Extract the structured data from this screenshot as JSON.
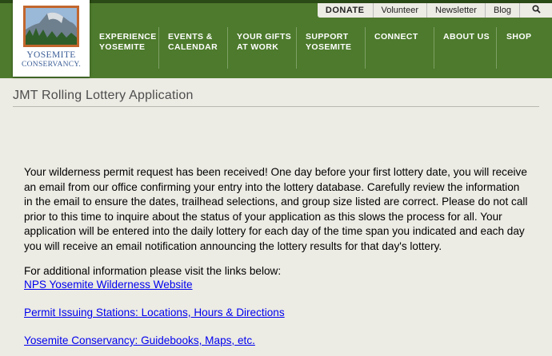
{
  "utility_nav": {
    "donate": "DONATE",
    "volunteer": "Volunteer",
    "newsletter": "Newsletter",
    "blog": "Blog",
    "search_icon": "search-icon"
  },
  "logo": {
    "line1": "YOSEMITE",
    "line2": "CONSERVANCY."
  },
  "main_nav": [
    {
      "line1": "EXPERIENCE",
      "line2": "YOSEMITE"
    },
    {
      "line1": "EVENTS &",
      "line2": "CALENDAR"
    },
    {
      "line1": "YOUR GIFTS",
      "line2": "AT WORK"
    },
    {
      "line1": "SUPPORT",
      "line2": "YOSEMITE"
    },
    {
      "line1": "CONNECT",
      "line2": ""
    },
    {
      "line1": "ABOUT US",
      "line2": ""
    },
    {
      "line1": "SHOP",
      "line2": ""
    }
  ],
  "page_title": "JMT Rolling Lottery Application",
  "body": {
    "paragraph": "Your wilderness permit request has been received! One day before your first lottery date, you will receive an email from our office confirming your entry into the lottery database. Carefully review the information in the email to ensure the dates, trailhead selections, and group size listed are correct. Please do not call prior to this time to inquire about the status of your application as this slows the process for all. Your application will be entered into the daily lottery for each day of the time span you indicated and each day you will receive an email notification announcing the lottery results for that day's lottery.",
    "info": "For additional information please visit the links below:",
    "links": [
      "NPS Yosemite Wilderness Website",
      "Permit Issuing Stations: Locations, Hours & Directions",
      "Yosemite Conservancy: Guidebooks, Maps, etc."
    ]
  },
  "colors": {
    "header_green": "#4d7a2c",
    "link_blue": "#0000ee",
    "logo_text_blue": "#3a5d96"
  }
}
